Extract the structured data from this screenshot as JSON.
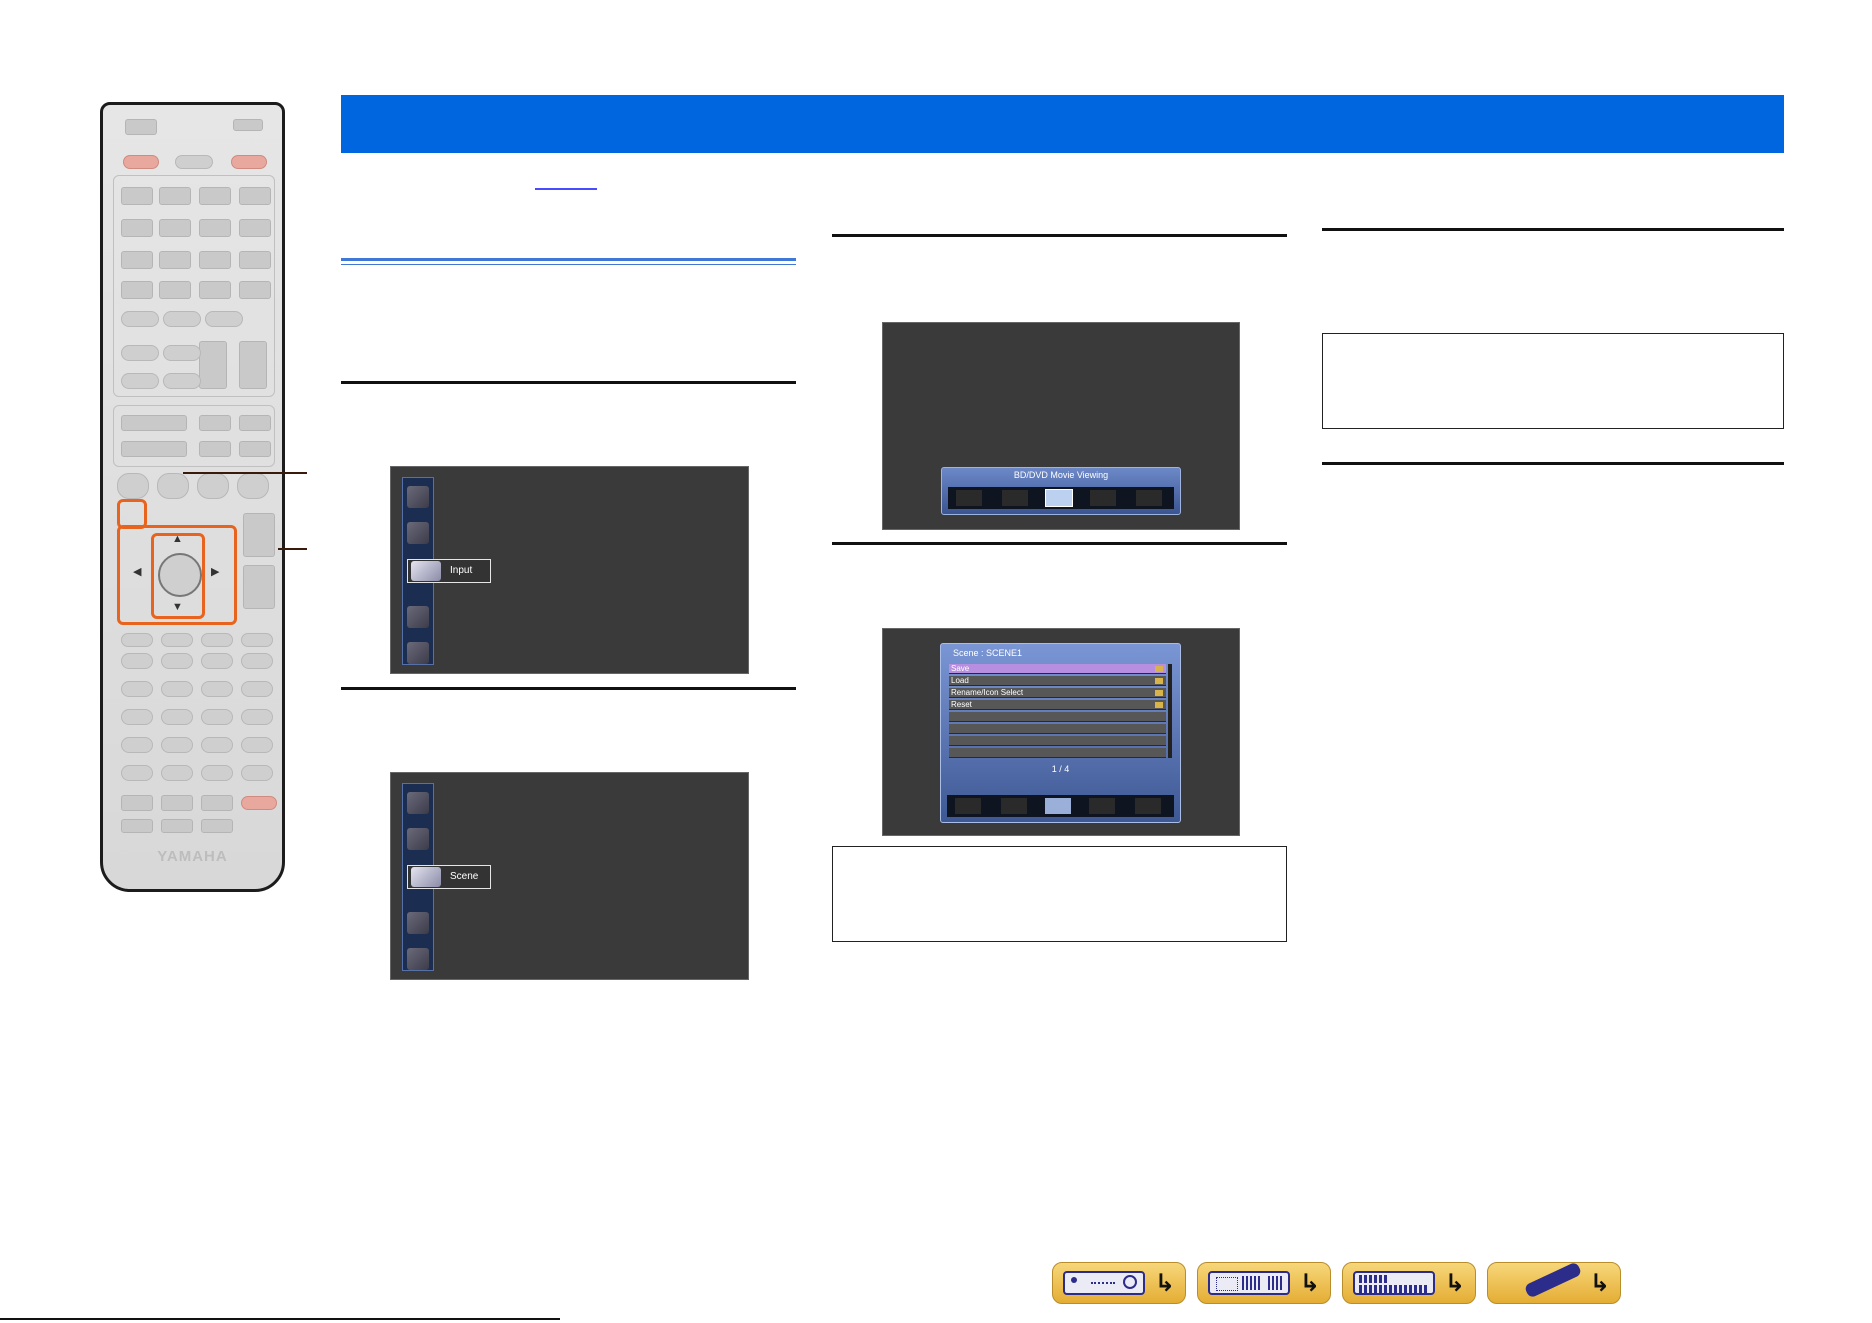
{
  "remote": {
    "brand": "YAMAHA"
  },
  "screens": {
    "screen1": {
      "selected_label": "Input"
    },
    "screen2": {
      "selected_label": "Scene"
    },
    "screen3": {
      "bar_title": "BD/DVD Movie Viewing"
    },
    "screen4": {
      "title": "Scene : SCENE1",
      "items": [
        "Save",
        "Load",
        "Rename/Icon Select",
        "Reset"
      ],
      "page": "1 / 4"
    }
  },
  "icons": {
    "nav1": "receiver-front-icon",
    "nav2": "receiver-rear-icon",
    "nav3": "menu-grid-icon",
    "nav4": "remote-control-icon",
    "arrow": "return-arrow-icon"
  },
  "colors": {
    "header": "#0066e0",
    "highlight": "#e8641e",
    "osd_background": "#3a3a3a",
    "menu_selected": "#b78ee0"
  }
}
